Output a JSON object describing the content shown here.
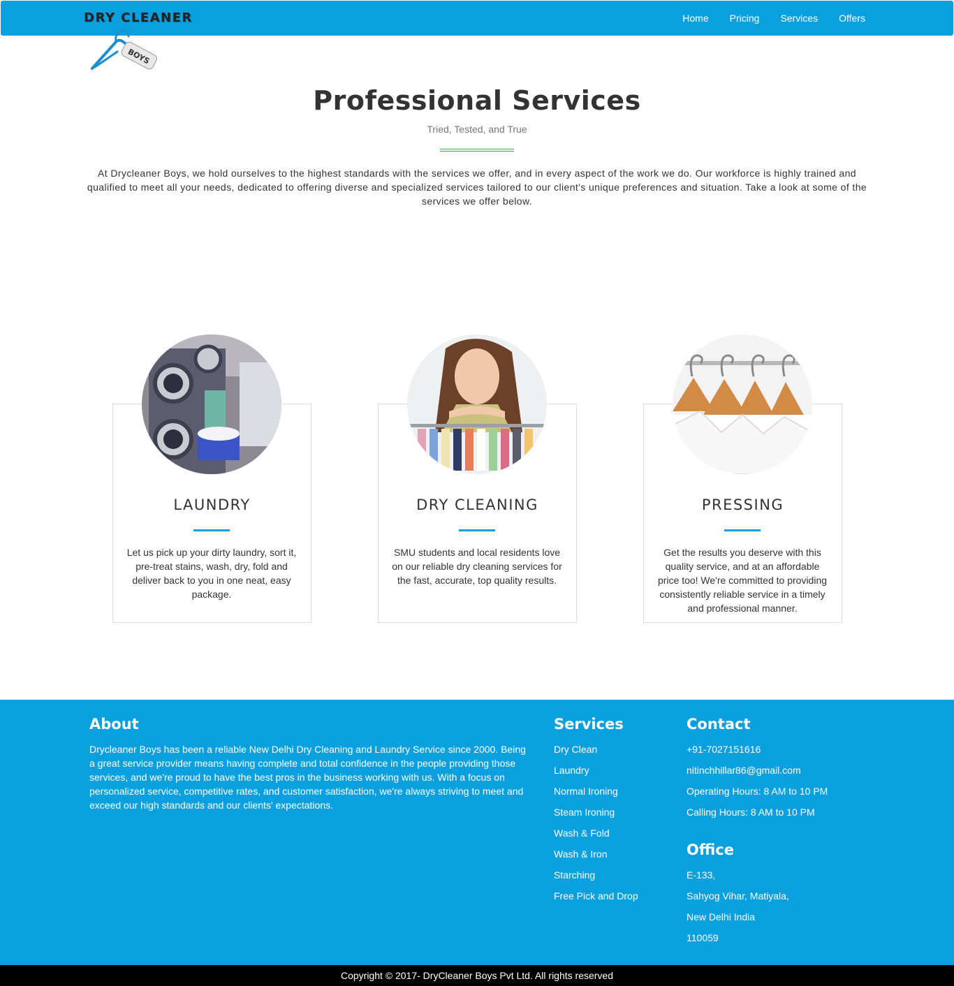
{
  "nav": {
    "brand": "DRY CLEANER",
    "logo_tag": "BOYS",
    "links": [
      "Home",
      "Pricing",
      "Services",
      "Offers"
    ]
  },
  "hero": {
    "title": "Professional Services",
    "subtitle": "Tried, Tested, and True",
    "text": "At Drycleaner Boys, we hold ourselves to the highest standards with the services we offer, and in every aspect of the work we do. Our workforce is highly trained and qualified to meet all your needs, dedicated to offering diverse and specialized services tailored to our client's unique preferences and situation. Take a look at some of the services we offer below."
  },
  "cards": [
    {
      "title": "LAUNDRY",
      "text": "Let us pick up your dirty laundry, sort it, pre-treat stains, wash, dry, fold and deliver back to you in one neat, easy package.",
      "image": "laundromat-photo"
    },
    {
      "title": "DRY CLEANING",
      "text": "SMU students and local residents love on our reliable dry cleaning services for the fast, accurate, top quality results.",
      "image": "woman-with-clothes-rack-photo"
    },
    {
      "title": "PRESSING",
      "text": "Get the results you deserve with this quality service, and at an affordable price too! We're committed to providing consistently reliable service in a timely and professional manner.",
      "image": "hangers-with-shirts-photo"
    }
  ],
  "footer": {
    "about_heading": "About",
    "about_text": "Drycleaner Boys has been a reliable New Delhi Dry Cleaning and Laundry Service since 2000. Being a great service provider means having complete and total confidence in the people providing those services, and we're proud to have the best pros in the business working with us. With a focus on personalized service, competitive rates, and customer satisfaction, we're always striving to meet and exceed our high standards and our clients' expectations.",
    "services_heading": "Services",
    "services": [
      "Dry Clean",
      "Laundry",
      "Normal Ironing",
      "Steam Ironing",
      "Wash & Fold",
      "Wash & Iron",
      "Starching",
      "Free Pick and Drop"
    ],
    "contact_heading": "Contact",
    "contact": [
      "+91-7027151616",
      "nitinchhillar86@gmail.com",
      "Operating Hours: 8 AM to 10 PM",
      "Calling Hours: 8 AM to 10 PM"
    ],
    "office_heading": "Office",
    "office": [
      "E-133,",
      "Sahyog Vihar, Matiyala,",
      "New Delhi India",
      "110059"
    ]
  },
  "copyright": "Copyright © 2017- DryCleaner Boys Pvt Ltd. All rights reserved",
  "colors": {
    "primary": "#0aa0e0",
    "accent_green": "#2ab24a",
    "footer_bottom": "#000000"
  }
}
